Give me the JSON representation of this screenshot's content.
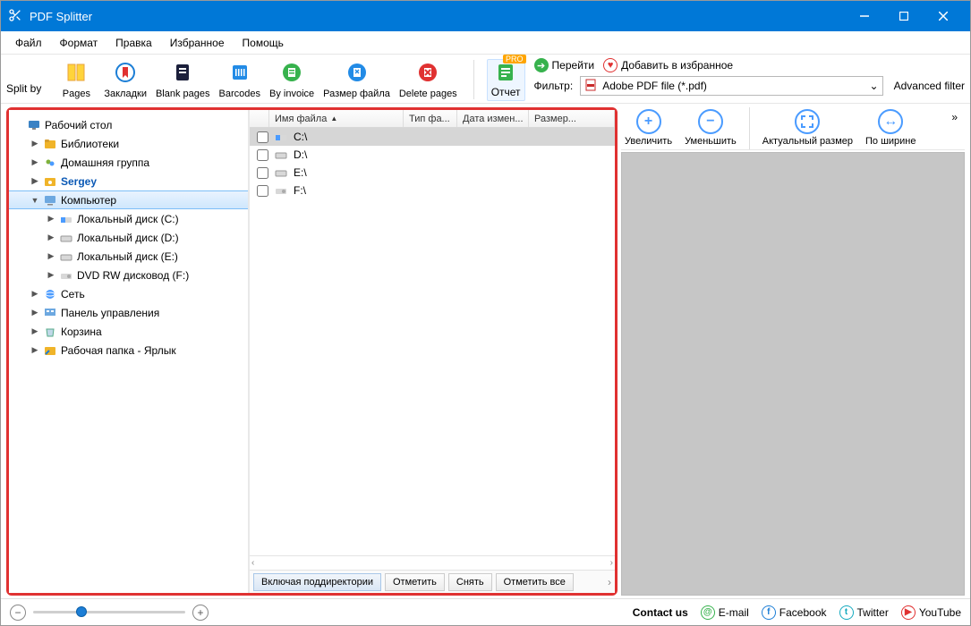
{
  "window": {
    "title": "PDF Splitter"
  },
  "menu": {
    "items": [
      "Файл",
      "Формат",
      "Правка",
      "Избранное",
      "Помощь"
    ]
  },
  "toolbar": {
    "split_by_label": "Split by",
    "buttons": [
      "Pages",
      "Закладки",
      "Blank pages",
      "Barcodes",
      "By invoice",
      "Размер файла",
      "Delete pages"
    ],
    "report": {
      "label": "Отчет",
      "badge": "PRO"
    },
    "go": "Перейти",
    "favorite": "Добавить в избранное",
    "filter_label": "Фильтр:",
    "filter_value": "Adobe PDF file (*.pdf)",
    "advanced": "Advanced filter"
  },
  "tree": {
    "items": [
      {
        "label": "Рабочий стол",
        "icon": "desktop",
        "depth": 0,
        "exp": ""
      },
      {
        "label": "Библиотеки",
        "icon": "libraries",
        "depth": 1,
        "exp": "▶"
      },
      {
        "label": "Домашняя группа",
        "icon": "homegroup",
        "depth": 1,
        "exp": "▶"
      },
      {
        "label": "Sergey",
        "icon": "user",
        "depth": 1,
        "exp": "▶",
        "cls": "user"
      },
      {
        "label": "Компьютер",
        "icon": "computer",
        "depth": 1,
        "exp": "▼",
        "cls": "selected"
      },
      {
        "label": "Локальный диск (C:)",
        "icon": "drive-c",
        "depth": 2,
        "exp": "▶"
      },
      {
        "label": "Локальный диск (D:)",
        "icon": "drive",
        "depth": 2,
        "exp": "▶"
      },
      {
        "label": "Локальный диск (E:)",
        "icon": "drive",
        "depth": 2,
        "exp": "▶"
      },
      {
        "label": "DVD RW дисковод (F:)",
        "icon": "dvd",
        "depth": 2,
        "exp": "▶"
      },
      {
        "label": "Сеть",
        "icon": "network",
        "depth": 1,
        "exp": "▶"
      },
      {
        "label": "Панель управления",
        "icon": "cpanel",
        "depth": 1,
        "exp": "▶"
      },
      {
        "label": "Корзина",
        "icon": "bin",
        "depth": 1,
        "exp": "▶"
      },
      {
        "label": "Рабочая папка - Ярлык",
        "icon": "shortcut",
        "depth": 1,
        "exp": "▶"
      }
    ]
  },
  "filelist": {
    "columns": [
      "",
      "Имя файла",
      "Тип фа...",
      "Дата измен...",
      "Размер..."
    ],
    "rows": [
      {
        "name": "C:\\",
        "icon": "drive-c",
        "sel": true
      },
      {
        "name": "D:\\",
        "icon": "drive",
        "sel": false
      },
      {
        "name": "E:\\",
        "icon": "drive",
        "sel": false
      },
      {
        "name": "F:\\",
        "icon": "dvd",
        "sel": false
      }
    ],
    "actions": {
      "include_sub": "Включая поддиректории",
      "check": "Отметить",
      "uncheck": "Снять",
      "check_all": "Отметить все"
    }
  },
  "zoom": {
    "in": "Увеличить",
    "out": "Уменьшить",
    "actual": "Актуальный размер",
    "fit_width": "По ширине"
  },
  "status": {
    "contact": "Contact us",
    "email": "E-mail",
    "facebook": "Facebook",
    "twitter": "Twitter",
    "youtube": "YouTube"
  }
}
